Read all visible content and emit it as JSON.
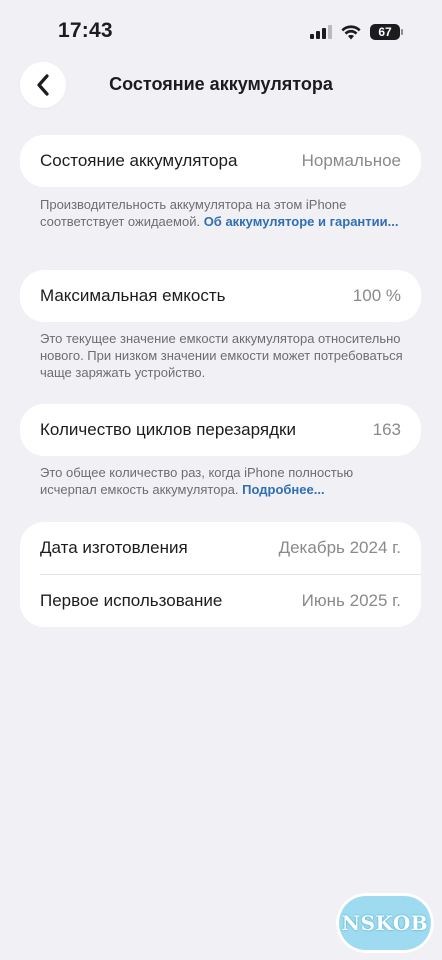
{
  "status_bar": {
    "time": "17:43",
    "battery_level": "67",
    "signal_icon": "cellular-signal-icon",
    "wifi_icon": "wifi-icon"
  },
  "nav": {
    "back_icon": "chevron-left-icon",
    "title": "Состояние аккумулятора"
  },
  "battery_health": {
    "label": "Состояние аккумулятора",
    "value": "Нормальное",
    "footnote_text": "Производительность аккумулятора на этом iPhone соответствует ожидаемой.",
    "footnote_link": "Об аккумуляторе и гарантии..."
  },
  "max_capacity": {
    "label": "Максимальная емкость",
    "value": "100 %",
    "footnote_text": "Это текущее значение емкости аккумулятора относительно нового. При низком значении емкости может потребоваться чаще заряжать устройство."
  },
  "cycle_count": {
    "label": "Количество циклов перезарядки",
    "value": "163",
    "footnote_text": "Это общее количество раз, когда iPhone полностью исчерпал емкость аккумулятора.",
    "footnote_link": "Подробнее..."
  },
  "dates": {
    "manufacture_label": "Дата изготовления",
    "manufacture_value": "Декабрь 2024 г.",
    "first_use_label": "Первое использование",
    "first_use_value": "Июнь 2025 г."
  },
  "watermark": {
    "text": "NSKOB"
  },
  "colors": {
    "background": "#f1f0f5",
    "card": "#ffffff",
    "link": "#2f6fb3",
    "secondary_text": "#8a8a8e"
  }
}
